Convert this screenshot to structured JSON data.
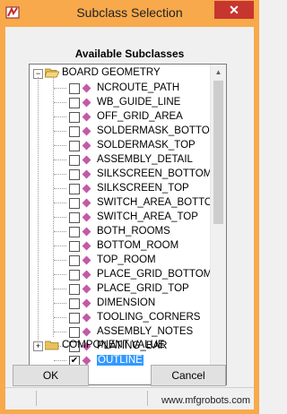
{
  "window": {
    "title": "Subclass Selection",
    "close_glyph": "✕",
    "app_icon": "allegro-app-icon"
  },
  "heading": "Available Subclasses",
  "tree": {
    "root": {
      "label": "BOARD GEOMETRY",
      "expander": "−",
      "icon": "open-folder-icon"
    },
    "items": [
      {
        "label": "NCROUTE_PATH",
        "checked": false,
        "selected": false
      },
      {
        "label": "WB_GUIDE_LINE",
        "checked": false,
        "selected": false
      },
      {
        "label": "OFF_GRID_AREA",
        "checked": false,
        "selected": false
      },
      {
        "label": "SOLDERMASK_BOTTOM",
        "checked": false,
        "selected": false
      },
      {
        "label": "SOLDERMASK_TOP",
        "checked": false,
        "selected": false
      },
      {
        "label": "ASSEMBLY_DETAIL",
        "checked": false,
        "selected": false
      },
      {
        "label": "SILKSCREEN_BOTTOM",
        "checked": false,
        "selected": false
      },
      {
        "label": "SILKSCREEN_TOP",
        "checked": false,
        "selected": false
      },
      {
        "label": "SWITCH_AREA_BOTTOM",
        "checked": false,
        "selected": false
      },
      {
        "label": "SWITCH_AREA_TOP",
        "checked": false,
        "selected": false
      },
      {
        "label": "BOTH_ROOMS",
        "checked": false,
        "selected": false
      },
      {
        "label": "BOTTOM_ROOM",
        "checked": false,
        "selected": false
      },
      {
        "label": "TOP_ROOM",
        "checked": false,
        "selected": false
      },
      {
        "label": "PLACE_GRID_BOTTOM",
        "checked": false,
        "selected": false
      },
      {
        "label": "PLACE_GRID_TOP",
        "checked": false,
        "selected": false
      },
      {
        "label": "DIMENSION",
        "checked": false,
        "selected": false
      },
      {
        "label": "TOOLING_CORNERS",
        "checked": false,
        "selected": false
      },
      {
        "label": "ASSEMBLY_NOTES",
        "checked": false,
        "selected": false
      },
      {
        "label": "PLATING_BAR",
        "checked": false,
        "selected": false
      },
      {
        "label": "OUTLINE",
        "checked": true,
        "selected": true
      }
    ],
    "next_root": {
      "label": "COMPONENT VALUE",
      "expander": "+",
      "icon": "closed-folder-icon"
    },
    "check_glyph": "✔"
  },
  "buttons": {
    "ok": "OK",
    "cancel": "Cancel"
  },
  "scrollbar": {
    "up": "▲",
    "down": "▼"
  },
  "watermark": "www.mfgrobots.com",
  "colors": {
    "frame": "#f7a94b",
    "close": "#c7352f",
    "selection": "#3399ff",
    "subclass_diamond": "#c25aa6"
  }
}
